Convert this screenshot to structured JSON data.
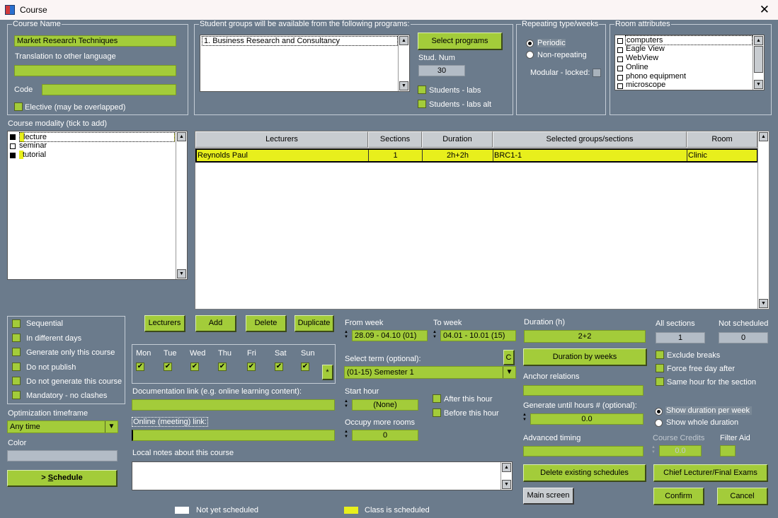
{
  "window": {
    "title": "Course",
    "close_glyph": "✕"
  },
  "course_name": {
    "legend": "Course Name",
    "value": "Market Research Techniques",
    "translation_label": "Translation to other language",
    "translation_value": "",
    "code_label": "Code",
    "code_value": "",
    "elective_label": "Elective (may be overlapped)"
  },
  "student_groups": {
    "legend": "Student groups will be available from the following programs:",
    "programs": [
      "1. Business Research and Consultancy"
    ],
    "select_button": "Select programs",
    "stud_num_label": "Stud. Num",
    "stud_num_value": "30",
    "labs_label": "Students - labs",
    "labs_alt_label": "Students - labs alt"
  },
  "repeating": {
    "legend": "Repeating type/weeks",
    "periodic": "Periodic",
    "non_repeating": "Non-repeating",
    "modular_label": "Modular - locked:"
  },
  "room_attributes": {
    "legend": "Room attributes",
    "items": [
      "computers",
      "Eagle View",
      "WebView",
      "Online",
      "phono equipment",
      "microscope"
    ]
  },
  "modality": {
    "label": "Course modality (tick to add)",
    "items": [
      {
        "label": "lecture",
        "checked": true
      },
      {
        "label": "seminar",
        "checked": false
      },
      {
        "label": "tutorial",
        "checked": true
      }
    ]
  },
  "table": {
    "headers": [
      "Lecturers",
      "Sections",
      "Duration",
      "Selected groups/sections",
      "Room"
    ],
    "rows": [
      [
        "Reynolds Paul",
        "1",
        "2h+2h",
        "BRC1-1",
        "Clinic"
      ]
    ]
  },
  "options": {
    "items": [
      "Sequential",
      "In different days",
      "Generate only this course",
      "Do not publish",
      "Do not generate this course",
      "Mandatory - no clashes"
    ]
  },
  "optimization": {
    "label": "Optimization timeframe",
    "value": "Any time"
  },
  "color_label": "Color",
  "schedule_button": "> Schedule",
  "schedule_button_prefix": "> ",
  "schedule_button_underlined": "S",
  "schedule_button_rest": "chedule",
  "action_buttons": {
    "lecturers": "Lecturers",
    "add": "Add",
    "delete": "Delete",
    "duplicate": "Duplicate"
  },
  "days": [
    "Mon",
    "Tue",
    "Wed",
    "Thu",
    "Fri",
    "Sat",
    "Sun"
  ],
  "day_star": "*",
  "doc_link": {
    "label": "Documentation link (e.g. online learning content):",
    "value": ""
  },
  "online_link": {
    "label": "Online (meeting) link:",
    "value": ""
  },
  "local_notes": {
    "label": "Local notes about this course",
    "value": ""
  },
  "weeks": {
    "from_label": "From week",
    "from_value": "28.09 - 04.10 (01)",
    "to_label": "To week",
    "to_value": "04.01 - 10.01 (15)"
  },
  "term": {
    "label": "Select term (optional):",
    "value": "(01-15) Semester 1",
    "c_button": "C"
  },
  "start_hour": {
    "label": "Start hour",
    "value": "(None)",
    "after": "After this hour",
    "before": "Before this hour"
  },
  "occupy_rooms": {
    "label": "Occupy more rooms",
    "value": "0"
  },
  "duration": {
    "label": "Duration (h)",
    "value": "2+2",
    "by_weeks_button": "Duration by weeks"
  },
  "anchor_label": "Anchor relations",
  "generate_until": {
    "label": "Generate until hours # (optional):",
    "value": "0.0"
  },
  "advanced_timing_label": "Advanced timing",
  "delete_schedules_button": "Delete existing schedules",
  "main_screen_button": "Main screen",
  "sections": {
    "all_label": "All sections",
    "all_value": "1",
    "not_label": "Not scheduled",
    "not_value": "0"
  },
  "right_checks": [
    "Exclude breaks",
    "Force free day after",
    "Same hour for the section"
  ],
  "show_duration": {
    "per_week": "Show duration per week",
    "whole": "Show whole duration"
  },
  "course_credits": {
    "label": "Course Credits",
    "value": "0.0"
  },
  "filter_aid_label": "Filter Aid",
  "chief_button": "Chief Lecturer/Final Exams",
  "confirm_button": "Confirm",
  "cancel_button": "Cancel",
  "legend_bottom": {
    "not_scheduled": "Not yet scheduled",
    "scheduled": "Class is scheduled"
  },
  "colors": {
    "bg": "#6b7b8c",
    "green": "#a3cc3a",
    "highlight": "#e8ef1c"
  }
}
